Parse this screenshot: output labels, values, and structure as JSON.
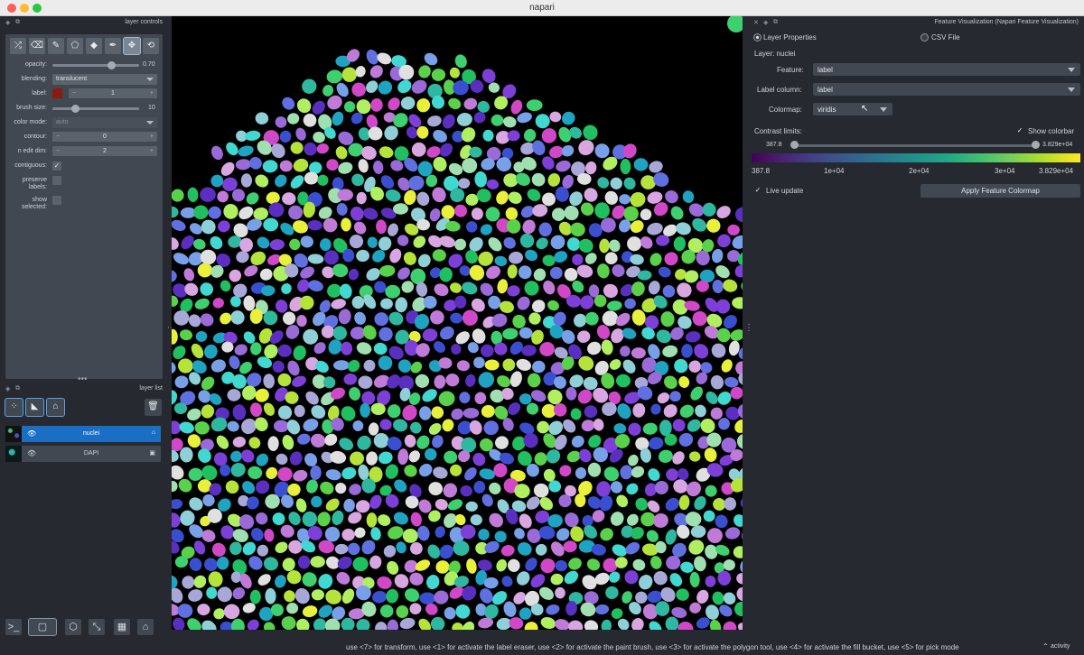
{
  "window": {
    "title": "napari"
  },
  "layer_controls": {
    "title": "layer controls",
    "tools": [
      "shuffle-icon",
      "eraser-icon",
      "brush-icon",
      "polygon-icon",
      "fill-bucket-icon",
      "picker-icon",
      "move-icon",
      "transform-icon"
    ],
    "opacity": {
      "label": "opacity:",
      "value": "0.70",
      "level": 0.7
    },
    "blending": {
      "label": "blending:",
      "value": "translucent"
    },
    "label": {
      "label": "label:",
      "value": "1",
      "color": "#8b1a10"
    },
    "brush_size": {
      "label": "brush size:",
      "value": "10",
      "level": 0.2
    },
    "color_mode": {
      "label": "color mode:",
      "value": "auto"
    },
    "contour": {
      "label": "contour:",
      "value": "0"
    },
    "n_edit_dim": {
      "label": "n edit dim:",
      "value": "2"
    },
    "contiguous": {
      "label": "contiguous:",
      "checked": true
    },
    "preserve_labels": {
      "label": "preserve labels:",
      "checked": false
    },
    "show_selected": {
      "label": "show selected:",
      "checked": false
    }
  },
  "layer_list": {
    "title": "layer list",
    "layers": [
      {
        "name": "nuclei",
        "selected": true,
        "type_icon": "tag-icon"
      },
      {
        "name": "DAPI",
        "selected": false,
        "type_icon": "image-icon"
      }
    ]
  },
  "feature_panel": {
    "title": "Feature Visualization (Napari Feature Visualization)",
    "source_options": [
      {
        "label": "Layer Properties",
        "selected": true
      },
      {
        "label": "CSV File",
        "selected": false
      }
    ],
    "layer_text": "Layer: nuclei",
    "feature": {
      "label": "Feature:",
      "value": "label"
    },
    "label_column": {
      "label": "Label column:",
      "value": "label"
    },
    "colormap": {
      "label": "Colormap:",
      "value": "viridis"
    },
    "contrast_limits": {
      "label": "Contrast limits:",
      "min": "387.8",
      "max": "3.829e+04"
    },
    "show_colorbar": {
      "label": "Show colorbar",
      "checked": true
    },
    "colorbar_ticks": [
      "387.8",
      "1e+04",
      "2e+04",
      "3e+04",
      "3.829e+04"
    ],
    "live_update": {
      "label": "Live update",
      "checked": true
    },
    "apply_button": "Apply Feature Colormap"
  },
  "status_bar": {
    "message": "use <7> for transform, use <1> for activate the label eraser, use <2> for activate the paint brush, use <3> for activate the polygon tool, use <4> for activate the fill bucket, use <5> for pick mode",
    "activity": "activity"
  }
}
